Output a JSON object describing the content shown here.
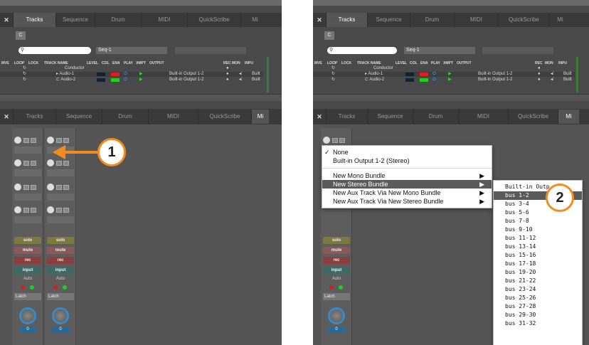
{
  "left": {
    "top_tabs": [
      "Tracks",
      "Sequence",
      "Drum",
      "MIDI",
      "QuickScribe",
      "Mi"
    ],
    "c_button": "C",
    "seq_value": "Seq-1",
    "headers": [
      "MVE",
      "LOOP",
      "LOCK",
      "TRACK NAME",
      "LEVEL",
      "COL",
      "ENA",
      "PLAY",
      "XMPT",
      "OUTPUT",
      "REC",
      "MON",
      "INPU"
    ],
    "tracks": [
      {
        "name": "Conductor",
        "output": "",
        "inp": ""
      },
      {
        "name": "Audio-1",
        "output": "Built-in Output 1-2",
        "inp": "Built"
      },
      {
        "name": "Audio-2",
        "output": "Built-in Output 1-2",
        "inp": "Built"
      }
    ],
    "lower_tabs": [
      "Tracks",
      "Sequence",
      "Drum",
      "MIDI",
      "QuickScribe",
      "Mi"
    ],
    "strip": {
      "solo": "solo",
      "mute": "mute",
      "rec": "rec",
      "input": "input",
      "auto": "Auto",
      "latch": "Latch",
      "value": "0"
    },
    "callout": "1"
  },
  "right": {
    "top_tabs": [
      "Tracks",
      "Sequence",
      "Drum",
      "MIDI",
      "QuickScribe",
      "Mi"
    ],
    "lower_tabs": [
      "Tracks",
      "Sequence",
      "Drum",
      "MIDI",
      "QuickScribe",
      "Mi"
    ],
    "menu": {
      "items": [
        "None",
        "Built-in Output 1-2 (Stereo)",
        "New Mono Bundle",
        "New Stereo Bundle",
        "New Aux Track Via New Mono Bundle",
        "New Aux Track Via New Stereo Bundle"
      ],
      "check": "✓",
      "arrow": "▶"
    },
    "submenu": [
      "Built-in Outp",
      "bus 1-2",
      "bus 3-4",
      "bus 5-6",
      "bus 7-8",
      "bus 9-10",
      "bus 11-12",
      "bus 13-14",
      "bus 15-16",
      "bus 17-18",
      "bus 19-20",
      "bus 21-22",
      "bus 23-24",
      "bus 25-26",
      "bus 27-28",
      "bus 29-30",
      "bus 31-32"
    ],
    "strip": {
      "solo": "solo",
      "mute": "mute",
      "rec": "rec",
      "input": "input",
      "auto": "Auto",
      "latch": "Latch",
      "value": "0"
    },
    "callout": "2"
  },
  "colors": {
    "accent": "#f28c1f",
    "red_track": "#e02020",
    "green_track": "#20d020"
  }
}
